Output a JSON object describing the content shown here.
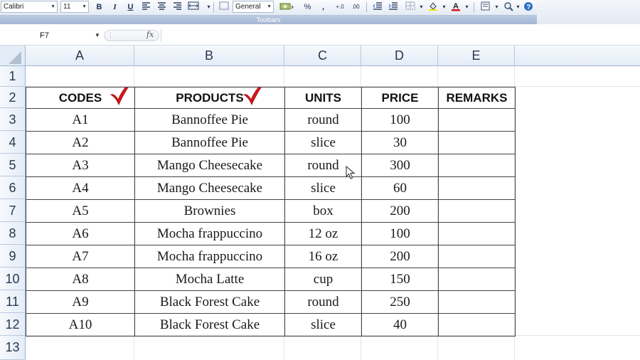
{
  "toolbar": {
    "font_name": "Calibri",
    "font_size": "11",
    "bold_label": "B",
    "italic_label": "I",
    "underline_label": "U",
    "number_format": "General",
    "percent_label": "%",
    "comma_label": ",",
    "increase_decimal_label": "+.0",
    "decrease_decimal_label": ".00",
    "caption": "Toolbars"
  },
  "formula_bar": {
    "name_box": "F7",
    "fx_label": "fx",
    "formula": ""
  },
  "columns": [
    "A",
    "B",
    "C",
    "D",
    "E"
  ],
  "rows": [
    "1",
    "2",
    "3",
    "4",
    "5",
    "6",
    "7",
    "8",
    "9",
    "10",
    "11",
    "12",
    "13"
  ],
  "table": {
    "headers": [
      "CODES",
      "PRODUCTS",
      "UNITS",
      "PRICE",
      "REMARKS"
    ],
    "rows": [
      {
        "code": "A1",
        "product": "Bannoffee Pie",
        "unit": "round",
        "price": "100",
        "remarks": ""
      },
      {
        "code": "A2",
        "product": "Bannoffee Pie",
        "unit": "slice",
        "price": "30",
        "remarks": ""
      },
      {
        "code": "A3",
        "product": "Mango Cheesecake",
        "unit": "round",
        "price": "300",
        "remarks": ""
      },
      {
        "code": "A4",
        "product": "Mango Cheesecake",
        "unit": "slice",
        "price": "60",
        "remarks": ""
      },
      {
        "code": "A5",
        "product": "Brownies",
        "unit": "box",
        "price": "200",
        "remarks": ""
      },
      {
        "code": "A6",
        "product": "Mocha frappuccino",
        "unit": "12 oz",
        "price": "100",
        "remarks": ""
      },
      {
        "code": "A7",
        "product": "Mocha frappuccino",
        "unit": "16 oz",
        "price": "200",
        "remarks": ""
      },
      {
        "code": "A8",
        "product": "Mocha Latte",
        "unit": "cup",
        "price": "150",
        "remarks": ""
      },
      {
        "code": "A9",
        "product": "Black Forest Cake",
        "unit": "round",
        "price": "250",
        "remarks": ""
      },
      {
        "code": "A10",
        "product": "Black Forest Cake",
        "unit": "slice",
        "price": "40",
        "remarks": ""
      }
    ]
  },
  "colors": {
    "check_mark": "#d8141c",
    "header_bg": "#e4ecf7",
    "grid_border": "#444444"
  },
  "icons": [
    "align-left-icon",
    "align-center-icon",
    "align-right-icon",
    "merge-icon",
    "currency-icon",
    "indent-icon",
    "borders-icon",
    "fill-color-icon",
    "font-color-icon",
    "print-preview-icon",
    "zoom-icon",
    "help-icon",
    "check-mark-icon",
    "mouse-cursor-icon"
  ]
}
